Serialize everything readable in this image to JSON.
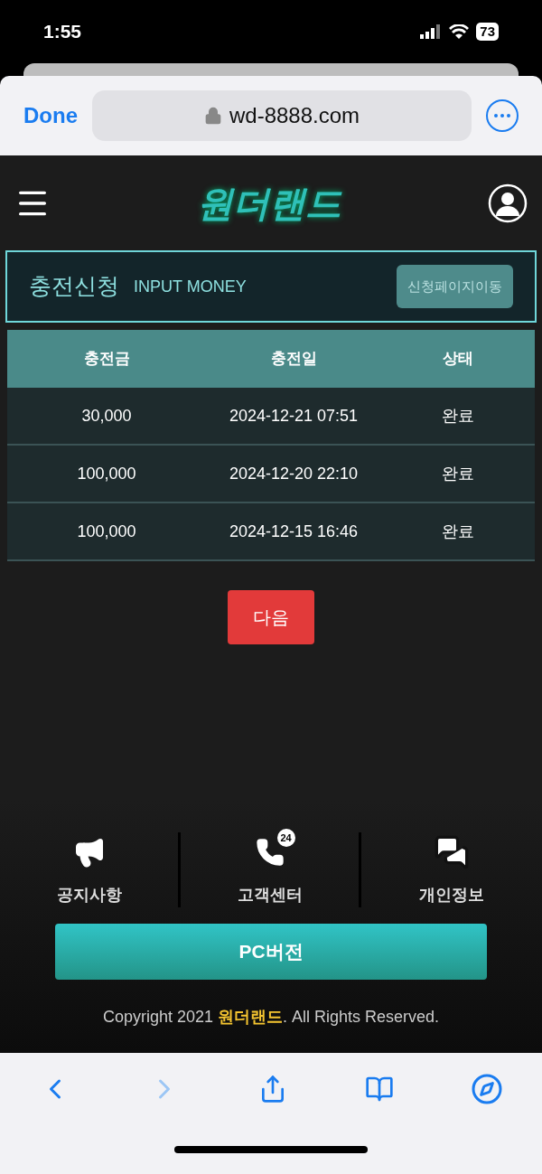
{
  "status_bar": {
    "time": "1:55",
    "battery": "73"
  },
  "browser": {
    "done": "Done",
    "url": "wd-8888.com"
  },
  "header": {
    "logo": "원더랜드"
  },
  "title_bar": {
    "title": "충전신청",
    "subtitle": "INPUT MONEY",
    "button": "신청페이지이동"
  },
  "table": {
    "columns": [
      "충전금",
      "충전일",
      "상태"
    ],
    "rows": [
      [
        "30,000",
        "2024-12-21 07:51",
        "완료"
      ],
      [
        "100,000",
        "2024-12-20 22:10",
        "완료"
      ],
      [
        "100,000",
        "2024-12-15 16:46",
        "완료"
      ]
    ]
  },
  "next_button": "다음",
  "footer": {
    "links": [
      {
        "kind": "megaphone",
        "label": "공지사항"
      },
      {
        "kind": "phone",
        "label": "고객센터",
        "badge": "24"
      },
      {
        "kind": "chat",
        "label": "개인정보"
      }
    ],
    "pc_button": "PC버전",
    "copyright": [
      "Copyright 2021 ",
      "원더랜드",
      ". All Rights Reserved."
    ]
  }
}
